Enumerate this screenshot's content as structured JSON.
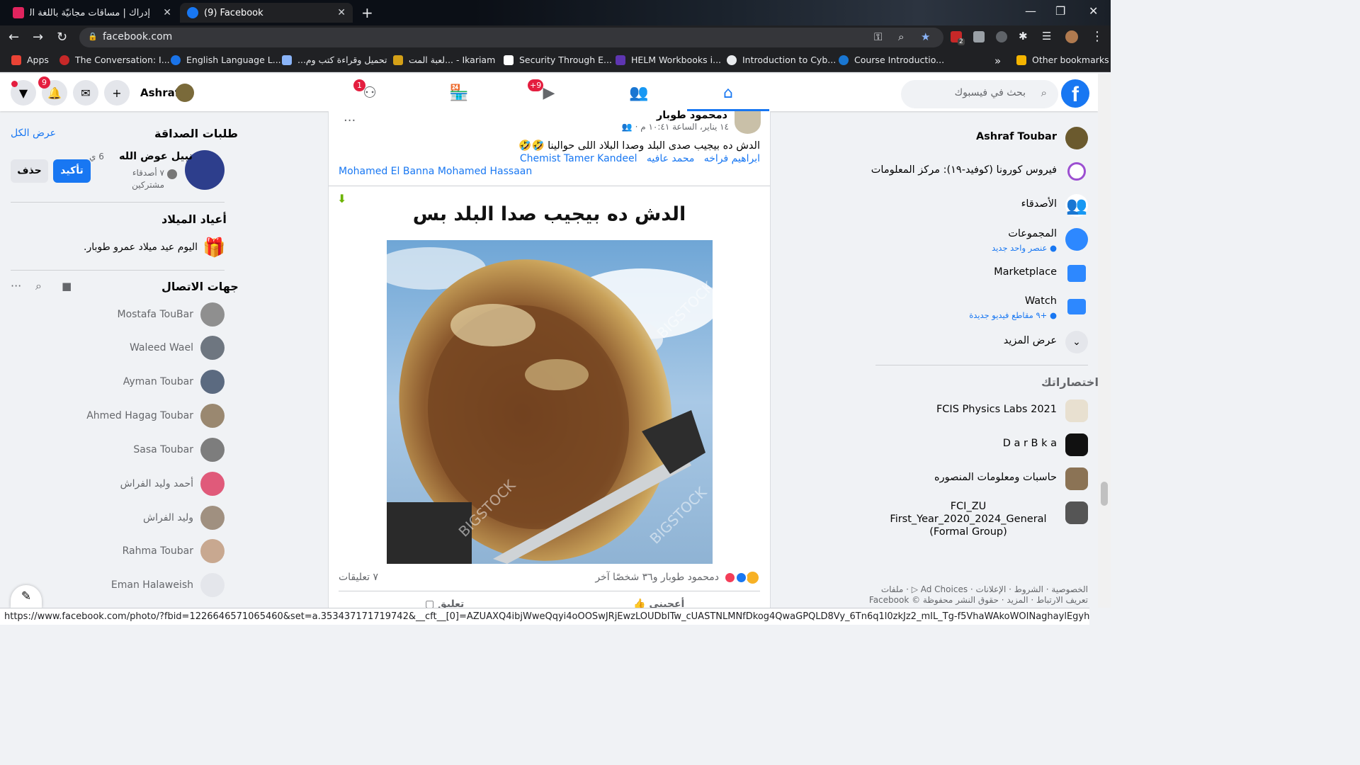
{
  "browser": {
    "tabs": [
      {
        "title": "إدراك | مساقات مجانيّة باللّغة العربيّة",
        "color": "#e0245e"
      },
      {
        "title": "(9) Facebook",
        "color": "#1877f2"
      }
    ],
    "url": "facebook.com",
    "bookmarks": [
      {
        "label": "Apps",
        "color": "#ea4335"
      },
      {
        "label": "The Conversation: I...",
        "color": "#c62828"
      },
      {
        "label": "English Language L...",
        "color": "#1a73e8"
      },
      {
        "label": "تحميل وقراءة كتب وم...",
        "color": "#8ab4f8"
      },
      {
        "label": "لعبة المت... - Ikariam",
        "color": "#d4a017"
      },
      {
        "label": "Security Through E...",
        "color": "#ffffff"
      },
      {
        "label": "HELM Workbooks i...",
        "color": "#5e35b1"
      },
      {
        "label": "Introduction to Cyb...",
        "color": "#e8eaed"
      },
      {
        "label": "Course Introductio...",
        "color": "#1976d2"
      }
    ],
    "overflow_label": "»",
    "other_bookmarks": "Other bookmarks",
    "extension_badge": "2"
  },
  "fb": {
    "user_name": "Ashraf",
    "notif_badge": "9",
    "groups_badge": "1",
    "watch_badge": "+9",
    "search_placeholder": "بحث في فيسبوك",
    "logo": "f"
  },
  "left": {
    "friend_requests_title": "طلبات الصداقة",
    "see_all": "عرض الكل",
    "request": {
      "name": "نبيل عوض الله",
      "time": "6 ي",
      "mutual": "٧ أصدقاء مشتركين",
      "confirm": "تأكيد",
      "delete": "حذف"
    },
    "birthdays_title": "أعياد الميلاد",
    "birthday_text": "اليوم عيد ميلاد عمرو طوبار.",
    "contacts_title": "جهات الاتصال",
    "contacts": [
      "Mostafa TouBar",
      "Waleed Wael",
      "Ayman Toubar",
      "Ahmed Hagag Toubar",
      "Sasa Toubar",
      "أحمد وليد الفراش",
      "وليد الفراش",
      "Rahma Toubar",
      "Eman Halaweish"
    ]
  },
  "post": {
    "author": "دمحمود طوبار",
    "meta": "١٤ يناير، الساعة ١٠:٤١ م ·",
    "text": "الدش ده بيجيب صدى البلد وصدا البلاد اللى حوالينا 🤣🤣",
    "tags_line1": [
      "ابراهيم فراخه",
      "محمد عافيه",
      "Chemist Tamer Kandeel"
    ],
    "tags_line2": "Mohamed El Banna Mohamed Hassaan",
    "image_caption": "الدش ده بيجيب صدا البلد بس",
    "watermark": "BIGSTOCK",
    "reactions_text": "دمحمود طوبار و٣٦ شخصًا آخر",
    "comments_count": "٧ تعليقات",
    "like": "أعجبني",
    "comment": "تعليق"
  },
  "right": {
    "items": [
      {
        "label": "Ashraf Toubar",
        "sub": "",
        "color": "#6b5a2e"
      },
      {
        "label": "فيروس كورونا (كوفيد-١٩): مركز المعلومات",
        "sub": "",
        "color": "#9c4fd1"
      },
      {
        "label": "الأصدقاء",
        "sub": "",
        "color": "#3b91e8"
      },
      {
        "label": "المجموعات",
        "sub": "● عنصر واحد جديد",
        "color": "#2d88ff"
      },
      {
        "label": "Marketplace",
        "sub": "",
        "color": "#2d88ff"
      },
      {
        "label": "Watch",
        "sub": "● +٩ مقاطع فيديو جديدة",
        "color": "#2d88ff"
      },
      {
        "label": "عرض المزيد",
        "sub": "",
        "color": "#e4e6eb"
      }
    ],
    "shortcuts_title": "اختصاراتك",
    "shortcuts": [
      {
        "label": "FCIS Physics Labs 2021",
        "color": "#e8e0d0"
      },
      {
        "label": "D a r B k a",
        "color": "#111111"
      },
      {
        "label": "حاسبات ومعلومات المنصوره",
        "color": "#8b7355"
      },
      {
        "label": "FCI_ZU First_Year_2020_2024_General (Formal Group)",
        "color": "#555555"
      }
    ],
    "footer_line1": "الخصوصية · الشروط · الإعلانات · Ad Choices ▷ · ملفات",
    "footer_line2": "تعريف الارتباط · المزيد · حقوق النشر محفوظة © Facebook"
  },
  "status_url": "https://www.facebook.com/photo/?fbid=1226646571065460&set=a.353437171719742&__cft__[0]=AZUAXQ4ibjWweQqyi4oOOSwJRjEwzLOUDbITw_cUASTNLMNfDkog4QwaGPQLD8Vy_6Tn6q1l0zkJz2_mIL_Tg-f5VhaWAkoWOINaghaylEgyh5gnSVVPRbtv2-dmYbxb_MHfjiUCOaEdqT-K..."
}
